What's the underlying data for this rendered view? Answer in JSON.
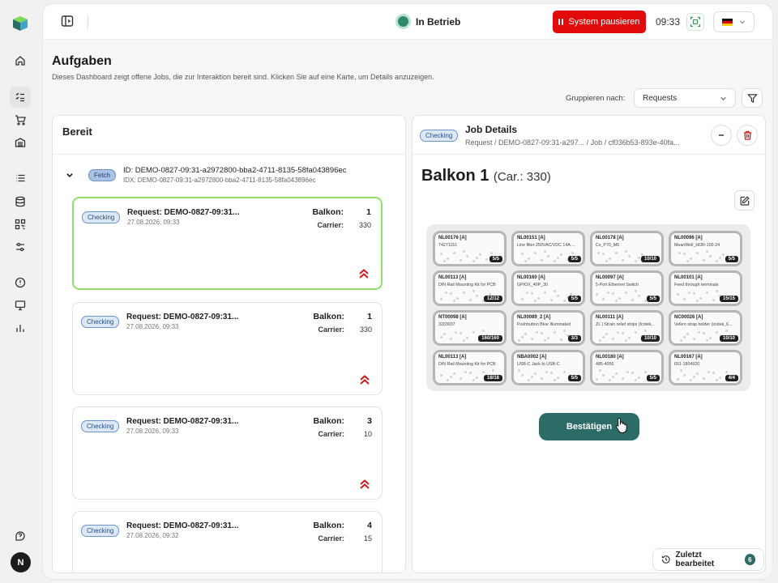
{
  "topbar": {
    "status": "In Betrieb",
    "pause_label": "System pausieren",
    "time": "09:33",
    "colors": {
      "pause": "#e20b0b",
      "status": "#2f8a6a"
    }
  },
  "page": {
    "title": "Aufgaben",
    "subtitle": "Dieses Dashboard zeigt offene Jobs, die zur Interaktion bereit sind. Klicken Sie auf eine Karte, um Details anzuzeigen.",
    "group_label": "Gruppieren nach:",
    "group_value": "Requests"
  },
  "left_panel": {
    "title": "Bereit",
    "group": {
      "badge": "Fetch",
      "id": "ID: DEMO-0827-09:31-a2972800-bba2-4711-8135-58fa043896ec",
      "idx": "IDX: DEMO-0827-09:31-a2972800-bba2-4711-8135-58fa043896ec"
    },
    "balkon_label": "Balkon:",
    "carrier_label": "Carrier:",
    "jobs": [
      {
        "badge": "Checking",
        "title": "Request: DEMO-0827-09:31...",
        "date": "27.08.2026, 09:33",
        "balkon": "1",
        "carrier": "330"
      },
      {
        "badge": "Checking",
        "title": "Request: DEMO-0827-09:31...",
        "date": "27.08.2026, 09:33",
        "balkon": "1",
        "carrier": "330"
      },
      {
        "badge": "Checking",
        "title": "Request: DEMO-0827-09:31...",
        "date": "27.08.2026, 09:33",
        "balkon": "3",
        "carrier": "10"
      },
      {
        "badge": "Checking",
        "title": "Request: DEMO-0827-09:31...",
        "date": "27.08.2026, 09:32",
        "balkon": "4",
        "carrier": "15"
      }
    ]
  },
  "right_panel": {
    "badge": "Checking",
    "title": "Job Details",
    "breadcrumb": "Request / DEMO-0827-09:31-a297... / Job / cf036b53-893e-40fa...",
    "balkon": "Balkon 1",
    "carrier": "(Car.: 330)",
    "cells": [
      {
        "code": "NL00176 [A]",
        "name": "74271151",
        "count": "5/5"
      },
      {
        "code": "NL00151 [A]",
        "name": "Line filter 250VAC/VDC 14A ...",
        "count": "5/5"
      },
      {
        "code": "NL00178 [A]",
        "name": "Cs_P70_M6",
        "count": "10/10"
      },
      {
        "code": "NL00096 [A]",
        "name": "MeanWell_HDR-100-24",
        "count": "5/5"
      },
      {
        "code": "NL00113 [A]",
        "name": "DIN Rail Mounting Kit for PCB",
        "count": "12/12"
      },
      {
        "code": "NL00160 [A]",
        "name": "GPIOX_40P_30",
        "count": "5/5"
      },
      {
        "code": "NL00097 [A]",
        "name": "5-Port Ethernet Switch",
        "count": "5/5"
      },
      {
        "code": "NL00101 [A]",
        "name": "Feed through terminals",
        "count": "15/15"
      },
      {
        "code": "NT00098 [A]",
        "name": "3203037",
        "count": "160/160"
      },
      {
        "code": "NL00089_2 [A]",
        "name": "Pushbutton Blue Illuminated",
        "count": "3/3"
      },
      {
        "code": "NL00111 [A]",
        "name": "ZL | Strain relief strips (Icotek...",
        "count": "10/10"
      },
      {
        "code": "NC00026 [A]",
        "name": "Velkro strap holder (icotek_6...",
        "count": "10/10"
      },
      {
        "code": "NL00113 [A]",
        "name": "DIN Rail Mounting Kit for PCB",
        "count": "18/18"
      },
      {
        "code": "NBA0002 [A]",
        "name": "USB-C Jack to USB-C",
        "count": "5/5"
      },
      {
        "code": "NL00180 [A]",
        "name": "485-4056",
        "count": "5/5"
      },
      {
        "code": "NL00167 [A]",
        "name": "651-1804920",
        "count": "4/4"
      }
    ],
    "confirm_label": "Bestätigen"
  },
  "recent": {
    "label": "Zuletzt bearbeitet",
    "count": "6"
  },
  "user": {
    "initial": "N"
  }
}
